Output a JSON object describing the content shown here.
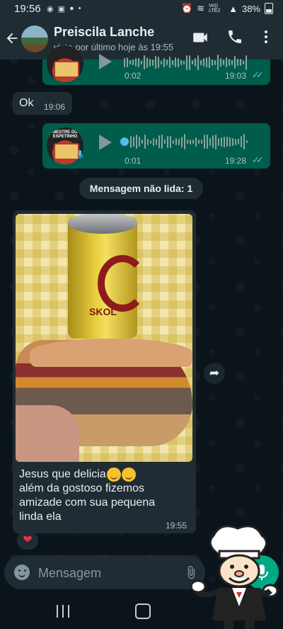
{
  "status_bar": {
    "time": "19:56",
    "left_icons": [
      "whatsapp-icon",
      "image-icon",
      "messenger-icon",
      "dot"
    ],
    "network": "Vo)) LTE2",
    "battery": "38%"
  },
  "header": {
    "contact_name": "Preiscila Lanche",
    "last_seen": "visto por último hoje às 19:55"
  },
  "messages": [
    {
      "type": "voice",
      "direction": "out",
      "duration": "0:02",
      "time": "19:03",
      "status": "read"
    },
    {
      "type": "text",
      "direction": "in",
      "text": "Ok",
      "time": "19:06"
    },
    {
      "type": "voice",
      "direction": "out",
      "duration": "0:01",
      "time": "19:28",
      "status": "read",
      "thumb_text": "MESTRE DO ESPETINHO"
    },
    {
      "type": "image",
      "direction": "in",
      "caption_lines": [
        "Jesus que delicia",
        "além da gostoso fizemos",
        "amizade com sua pequena",
        "linda ela"
      ],
      "time": "19:55",
      "reaction": "❤",
      "image_text": "SKOL"
    }
  ],
  "unread_label": "Mensagem não lida: 1",
  "input": {
    "placeholder": "Mensagem"
  },
  "colors": {
    "background": "#0b141a",
    "header": "#1f2c34",
    "outgoing_bubble": "#005c4b",
    "incoming_bubble": "#1f2c34",
    "read_ticks": "#53bdeb",
    "accent": "#00a884"
  }
}
